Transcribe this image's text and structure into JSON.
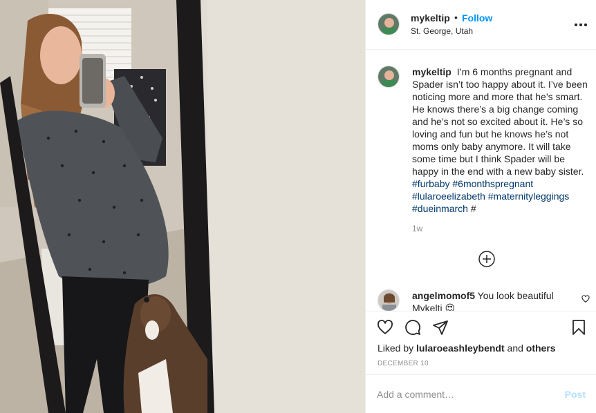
{
  "post": {
    "username": "mykeltip",
    "follow_label": "Follow",
    "separator": "•",
    "location": "St. George, Utah",
    "more_icon": "more-options-icon"
  },
  "caption": {
    "username": "mykeltip",
    "text": "I’m 6 months pregnant and Spader isn’t too happy about it. I’ve been noticing more and more that he’s smart. He knows there’s a big change coming and he’s not so excited about it. He’s so loving and fun but he knows he’s not moms only baby anymore. It will take some time but I think Spader will be happy in the end with a new baby sister.",
    "hashtags": [
      "#furbaby",
      "#6monthspregnant",
      "#lularoeelizabeth",
      "#maternityleggings",
      "#dueinmarch",
      "#"
    ],
    "time_ago": "1w"
  },
  "comments": [
    {
      "username": "angelmomof5",
      "text": "You look beautiful Mykelti 😍"
    }
  ],
  "actions": {
    "icons": [
      "heart-icon",
      "comment-icon",
      "share-icon",
      "bookmark-icon"
    ],
    "liked_by_prefix": "Liked by",
    "liked_by_user": "lularoeashleybendt",
    "liked_by_and": "and",
    "liked_by_others": "others",
    "date": "DECEMBER 10"
  },
  "add_comment": {
    "placeholder": "Add a comment…",
    "post_label": "Post"
  },
  "colors": {
    "link": "#0095f6",
    "hashtag": "#00376b",
    "muted": "#8e8e8e",
    "post_disabled": "#b2dffc"
  }
}
